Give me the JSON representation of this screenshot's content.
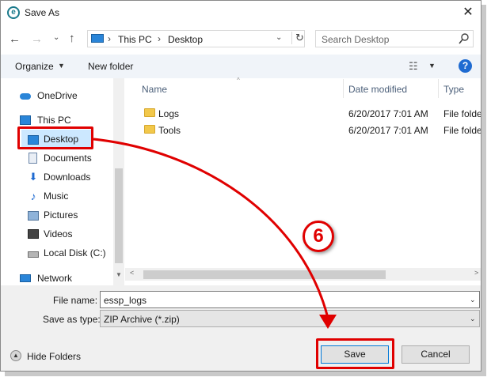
{
  "window": {
    "title": "Save As",
    "app_icon_glyph": "e"
  },
  "nav": {
    "back_glyph": "←",
    "forward_glyph": "→",
    "recent_glyph": "⌄",
    "up_glyph": "↑",
    "breadcrumbs": [
      "This PC",
      "Desktop"
    ],
    "crumb_separator": "›",
    "refresh_glyph": "↻",
    "dropdown_glyph": "⌄"
  },
  "search": {
    "placeholder": "Search Desktop",
    "icon": "search-icon"
  },
  "toolbar": {
    "organize_label": "Organize",
    "new_folder_label": "New folder",
    "caret": "▼",
    "view_glyph": "☷",
    "help_glyph": "?"
  },
  "sidebar": {
    "items": [
      {
        "label": "OneDrive",
        "icon": "cloud-icon"
      },
      {
        "label": "This PC",
        "icon": "computer-icon"
      },
      {
        "label": "Desktop",
        "icon": "desktop-icon",
        "selected": true
      },
      {
        "label": "Documents",
        "icon": "documents-icon"
      },
      {
        "label": "Downloads",
        "icon": "downloads-icon"
      },
      {
        "label": "Music",
        "icon": "music-icon"
      },
      {
        "label": "Pictures",
        "icon": "pictures-icon"
      },
      {
        "label": "Videos",
        "icon": "videos-icon"
      },
      {
        "label": "Local Disk (C:)",
        "icon": "local-disk-icon"
      },
      {
        "label": "Network",
        "icon": "network-icon"
      }
    ],
    "download_glyph": "⬇",
    "music_glyph": "♪"
  },
  "files": {
    "columns": [
      "Name",
      "Date modified",
      "Type"
    ],
    "sort_glyph": "^",
    "rows": [
      {
        "name": "Logs",
        "date": "6/20/2017 7:01 AM",
        "type": "File folder"
      },
      {
        "name": "Tools",
        "date": "6/20/2017 7:01 AM",
        "type": "File folder"
      }
    ]
  },
  "scroll": {
    "left_glyph": "<",
    "right_glyph": ">",
    "down_glyph": "▼"
  },
  "form": {
    "filename_label": "File name:",
    "filename_value": "essp_logs",
    "type_label": "Save as type:",
    "type_value": "ZIP Archive (*.zip)",
    "caret": "⌄"
  },
  "footer": {
    "hide_folders_label": "Hide Folders",
    "hide_glyph": "▲",
    "save_label": "Save",
    "cancel_label": "Cancel"
  },
  "annotation": {
    "step_number": "6",
    "color": "#e00000"
  },
  "close_glyph": "✕"
}
